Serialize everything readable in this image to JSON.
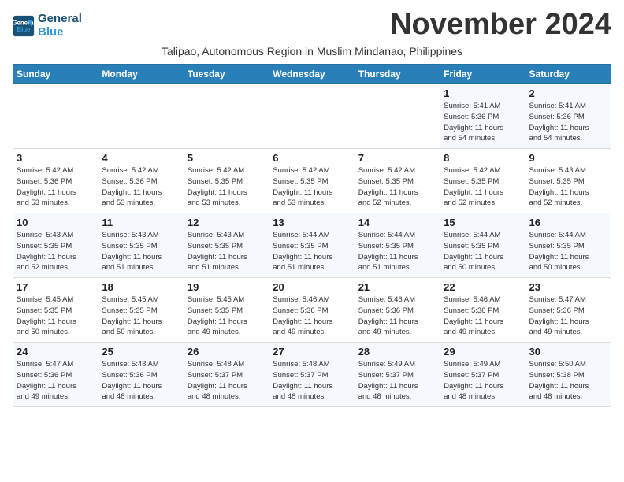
{
  "header": {
    "logo_line1": "General",
    "logo_line2": "Blue",
    "month_title": "November 2024",
    "subtitle": "Talipao, Autonomous Region in Muslim Mindanao, Philippines"
  },
  "days_of_week": [
    "Sunday",
    "Monday",
    "Tuesday",
    "Wednesday",
    "Thursday",
    "Friday",
    "Saturday"
  ],
  "weeks": [
    [
      {
        "day": "",
        "info": ""
      },
      {
        "day": "",
        "info": ""
      },
      {
        "day": "",
        "info": ""
      },
      {
        "day": "",
        "info": ""
      },
      {
        "day": "",
        "info": ""
      },
      {
        "day": "1",
        "info": "Sunrise: 5:41 AM\nSunset: 5:36 PM\nDaylight: 11 hours\nand 54 minutes."
      },
      {
        "day": "2",
        "info": "Sunrise: 5:41 AM\nSunset: 5:36 PM\nDaylight: 11 hours\nand 54 minutes."
      }
    ],
    [
      {
        "day": "3",
        "info": "Sunrise: 5:42 AM\nSunset: 5:36 PM\nDaylight: 11 hours\nand 53 minutes."
      },
      {
        "day": "4",
        "info": "Sunrise: 5:42 AM\nSunset: 5:36 PM\nDaylight: 11 hours\nand 53 minutes."
      },
      {
        "day": "5",
        "info": "Sunrise: 5:42 AM\nSunset: 5:35 PM\nDaylight: 11 hours\nand 53 minutes."
      },
      {
        "day": "6",
        "info": "Sunrise: 5:42 AM\nSunset: 5:35 PM\nDaylight: 11 hours\nand 53 minutes."
      },
      {
        "day": "7",
        "info": "Sunrise: 5:42 AM\nSunset: 5:35 PM\nDaylight: 11 hours\nand 52 minutes."
      },
      {
        "day": "8",
        "info": "Sunrise: 5:42 AM\nSunset: 5:35 PM\nDaylight: 11 hours\nand 52 minutes."
      },
      {
        "day": "9",
        "info": "Sunrise: 5:43 AM\nSunset: 5:35 PM\nDaylight: 11 hours\nand 52 minutes."
      }
    ],
    [
      {
        "day": "10",
        "info": "Sunrise: 5:43 AM\nSunset: 5:35 PM\nDaylight: 11 hours\nand 52 minutes."
      },
      {
        "day": "11",
        "info": "Sunrise: 5:43 AM\nSunset: 5:35 PM\nDaylight: 11 hours\nand 51 minutes."
      },
      {
        "day": "12",
        "info": "Sunrise: 5:43 AM\nSunset: 5:35 PM\nDaylight: 11 hours\nand 51 minutes."
      },
      {
        "day": "13",
        "info": "Sunrise: 5:44 AM\nSunset: 5:35 PM\nDaylight: 11 hours\nand 51 minutes."
      },
      {
        "day": "14",
        "info": "Sunrise: 5:44 AM\nSunset: 5:35 PM\nDaylight: 11 hours\nand 51 minutes."
      },
      {
        "day": "15",
        "info": "Sunrise: 5:44 AM\nSunset: 5:35 PM\nDaylight: 11 hours\nand 50 minutes."
      },
      {
        "day": "16",
        "info": "Sunrise: 5:44 AM\nSunset: 5:35 PM\nDaylight: 11 hours\nand 50 minutes."
      }
    ],
    [
      {
        "day": "17",
        "info": "Sunrise: 5:45 AM\nSunset: 5:35 PM\nDaylight: 11 hours\nand 50 minutes."
      },
      {
        "day": "18",
        "info": "Sunrise: 5:45 AM\nSunset: 5:35 PM\nDaylight: 11 hours\nand 50 minutes."
      },
      {
        "day": "19",
        "info": "Sunrise: 5:45 AM\nSunset: 5:35 PM\nDaylight: 11 hours\nand 49 minutes."
      },
      {
        "day": "20",
        "info": "Sunrise: 5:46 AM\nSunset: 5:36 PM\nDaylight: 11 hours\nand 49 minutes."
      },
      {
        "day": "21",
        "info": "Sunrise: 5:46 AM\nSunset: 5:36 PM\nDaylight: 11 hours\nand 49 minutes."
      },
      {
        "day": "22",
        "info": "Sunrise: 5:46 AM\nSunset: 5:36 PM\nDaylight: 11 hours\nand 49 minutes."
      },
      {
        "day": "23",
        "info": "Sunrise: 5:47 AM\nSunset: 5:36 PM\nDaylight: 11 hours\nand 49 minutes."
      }
    ],
    [
      {
        "day": "24",
        "info": "Sunrise: 5:47 AM\nSunset: 5:36 PM\nDaylight: 11 hours\nand 49 minutes."
      },
      {
        "day": "25",
        "info": "Sunrise: 5:48 AM\nSunset: 5:36 PM\nDaylight: 11 hours\nand 48 minutes."
      },
      {
        "day": "26",
        "info": "Sunrise: 5:48 AM\nSunset: 5:37 PM\nDaylight: 11 hours\nand 48 minutes."
      },
      {
        "day": "27",
        "info": "Sunrise: 5:48 AM\nSunset: 5:37 PM\nDaylight: 11 hours\nand 48 minutes."
      },
      {
        "day": "28",
        "info": "Sunrise: 5:49 AM\nSunset: 5:37 PM\nDaylight: 11 hours\nand 48 minutes."
      },
      {
        "day": "29",
        "info": "Sunrise: 5:49 AM\nSunset: 5:37 PM\nDaylight: 11 hours\nand 48 minutes."
      },
      {
        "day": "30",
        "info": "Sunrise: 5:50 AM\nSunset: 5:38 PM\nDaylight: 11 hours\nand 48 minutes."
      }
    ]
  ]
}
